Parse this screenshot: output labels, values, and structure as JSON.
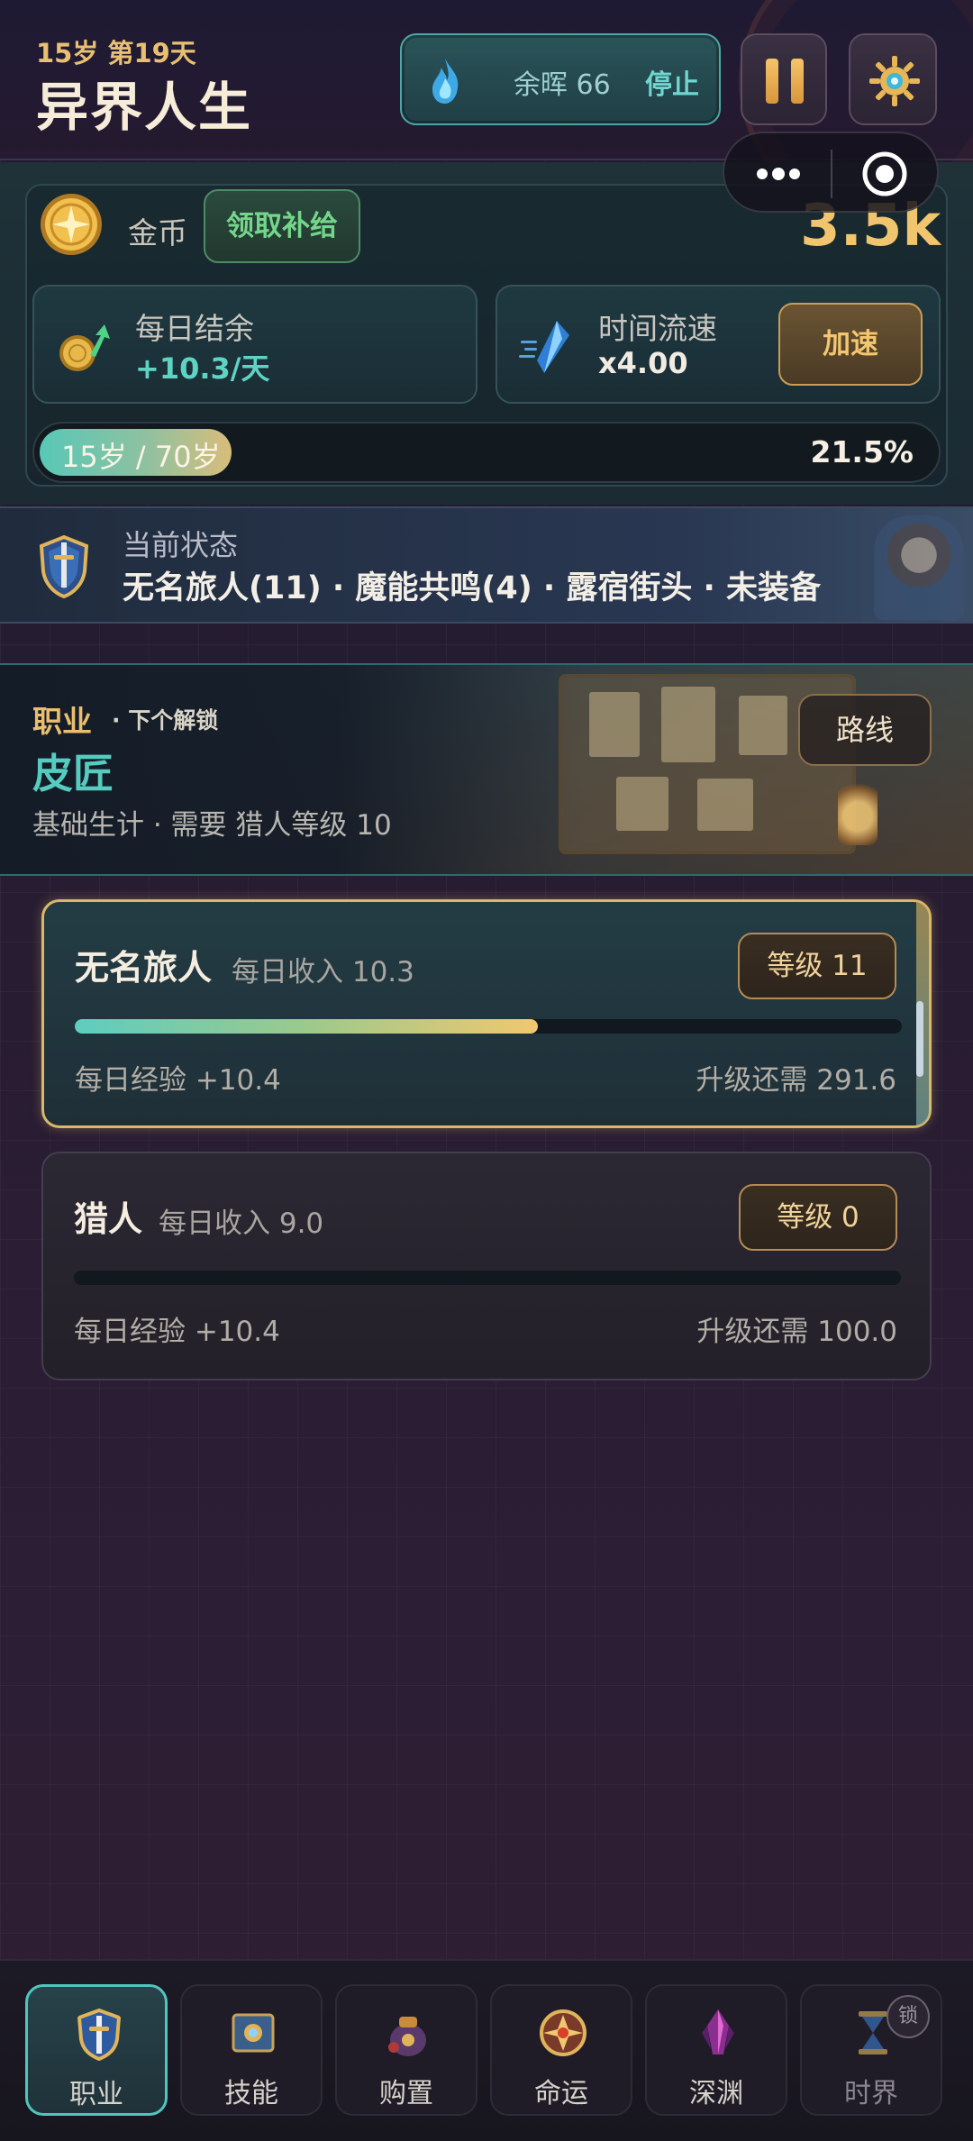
{
  "header": {
    "age_day": "15岁 第19天",
    "title": "异界人生",
    "ember_label": "余晖 66",
    "stop_label": "停止"
  },
  "gold": {
    "label": "金币",
    "claim_label": "领取补给",
    "amount": "3.5k"
  },
  "daily": {
    "label": "每日结余",
    "value": "+10.3/天"
  },
  "speed": {
    "label": "时间流速",
    "value": "x4.00",
    "button_label": "加速"
  },
  "age_progress": {
    "text": "15岁 / 70岁",
    "percent_text": "21.5%",
    "fraction": 0.215
  },
  "status": {
    "label": "当前状态",
    "value": "无名旅人(11) · 魔能共鸣(4) · 露宿街头 · 未装备"
  },
  "profession": {
    "section": "职业",
    "next_label": "· 下个解锁",
    "next_name": "皮匠",
    "next_desc": "基础生计 · 需要 猎人等级 10",
    "route_label": "路线"
  },
  "jobs": [
    {
      "name": "无名旅人",
      "income": "每日收入 10.3",
      "level": "等级 11",
      "exp": "每日经验 +10.4",
      "need": "升级还需 291.6",
      "progress": 0.56,
      "active": true
    },
    {
      "name": "猎人",
      "income": "每日收入 9.0",
      "level": "等级 0",
      "exp": "每日经验 +10.4",
      "need": "升级还需 100.0",
      "progress": 0,
      "active": false
    }
  ],
  "nav": {
    "tabs": [
      {
        "label": "职业",
        "icon": "shield-icon"
      },
      {
        "label": "技能",
        "icon": "spellbook-icon"
      },
      {
        "label": "购置",
        "icon": "bag-icon"
      },
      {
        "label": "命运",
        "icon": "fate-emblem-icon"
      },
      {
        "label": "深渊",
        "icon": "abyss-crystal-icon"
      },
      {
        "label": "时界",
        "icon": "hourglass-icon"
      }
    ],
    "lock_label": "锁"
  },
  "colors": {
    "accent_teal": "#4fc6bd",
    "accent_gold": "#e9bf6f",
    "positive_green": "#74d68b"
  }
}
